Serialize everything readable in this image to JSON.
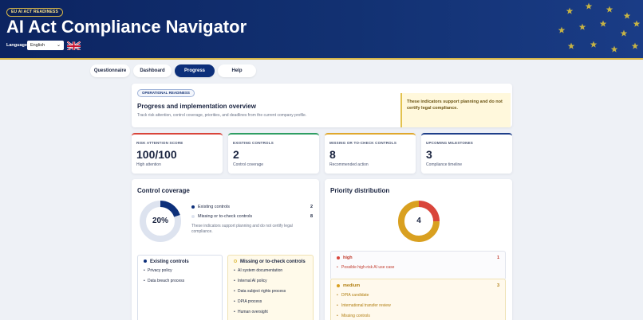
{
  "header": {
    "badge": "EU AI ACT READINESS",
    "title": "AI Act Compliance Navigator",
    "language_label": "Language",
    "language_value": "English"
  },
  "tabs": [
    {
      "label": "Questionnaire",
      "active": false
    },
    {
      "label": "Dashboard",
      "active": false
    },
    {
      "label": "Progress",
      "active": true
    },
    {
      "label": "Help",
      "active": false
    }
  ],
  "overview": {
    "pill": "OPERATIONAL READINESS",
    "title": "Progress and implementation overview",
    "subtitle": "Track risk attention, control coverage, priorities, and deadlines from the current company profile.",
    "note": "These indicators support planning and do not certify legal compliance."
  },
  "stats": [
    {
      "label": "RISK ATTENTION SCORE",
      "value": "100/100",
      "sub": "High attention",
      "color": "#d9453b"
    },
    {
      "label": "EXISTING CONTROLS",
      "value": "2",
      "sub": "Control coverage",
      "color": "#2f9e63"
    },
    {
      "label": "MISSING OR TO-CHECK CONTROLS",
      "value": "8",
      "sub": "Recommended action",
      "color": "#e0a82e"
    },
    {
      "label": "UPCOMING MILESTONES",
      "value": "3",
      "sub": "Compliance timeline",
      "color": "#1f3f8a"
    }
  ],
  "control_coverage": {
    "title": "Control coverage",
    "percent_label": "20%",
    "percent": 0.2,
    "legend": [
      {
        "label": "Existing controls",
        "count": "2",
        "color": "#0c2f7a"
      },
      {
        "label": "Missing or to-check controls",
        "count": "8",
        "color": "#dde3ef"
      }
    ],
    "note": "These indicators support planning and do not certify legal compliance.",
    "existing": {
      "title": "Existing controls",
      "items": [
        "Privacy policy",
        "Data breach process"
      ]
    },
    "missing": {
      "title": "Missing or to-check controls",
      "items": [
        "AI system documentation",
        "Internal AI policy",
        "Data subject rights process",
        "DPIA process",
        "Human oversight"
      ]
    }
  },
  "priority": {
    "title": "Priority distribution",
    "total": "4",
    "segments": [
      {
        "name": "high",
        "count": 1,
        "color": "#d9453b"
      },
      {
        "name": "medium",
        "count": 3,
        "color": "#d9a020"
      }
    ],
    "groups": [
      {
        "name": "high",
        "count": "1",
        "color": "#d9453b",
        "items": [
          "Possible high-risk AI use case"
        ]
      },
      {
        "name": "medium",
        "count": "3",
        "color": "#d9a020",
        "items": [
          "DPIA candidate",
          "International transfer review",
          "Missing controls"
        ]
      }
    ]
  }
}
